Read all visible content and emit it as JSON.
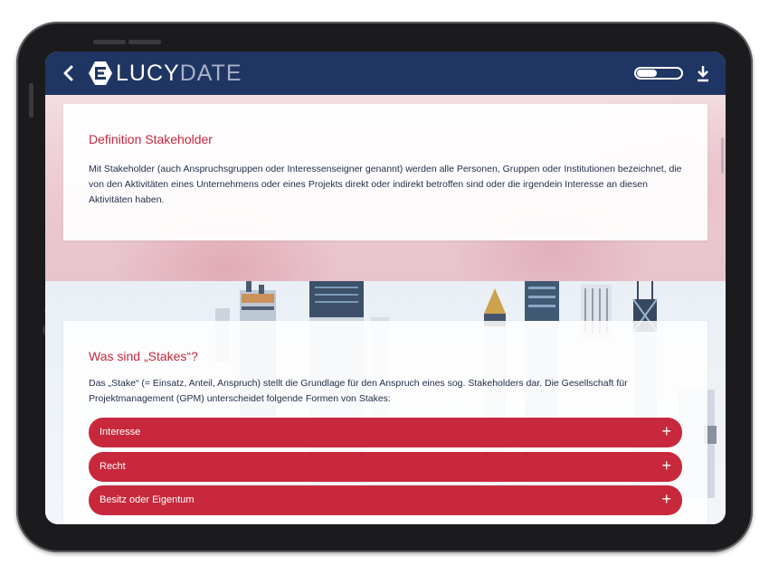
{
  "app": {
    "brand_part1": "LUCY",
    "brand_part2": "DATE"
  },
  "colors": {
    "appbar": "#1f3564",
    "accent": "#c8283c",
    "text": "#1f2c4a"
  },
  "icons": {
    "back": "chevron-left-icon",
    "logo": "lucydate-logo-icon",
    "toggle": "toggle-switch-icon",
    "download": "download-icon",
    "expand": "plus-icon"
  },
  "definition": {
    "title": "Definition Stakeholder",
    "text": "Mit Stakeholder (auch Anspruchsgruppen oder Interessenseigner genannt) werden alle Personen, Gruppen oder Institutionen bezeichnet, die von den Aktivitäten eines Unternehmens oder eines Projekts direkt oder indirekt betroffen sind oder die irgendein Interesse an diesen Aktivitäten haben."
  },
  "stakes": {
    "title": "Was sind „Stakes“?",
    "text": "Das „Stake“ (= Einsatz, Anteil, Anspruch) stellt die Grundlage für den Anspruch eines sog. Stakeholders dar. Die Gesellschaft für Projektmanagement (GPM) unterscheidet folgende Formen von Stakes:",
    "items": [
      {
        "label": "Interesse",
        "icon": "+"
      },
      {
        "label": "Recht",
        "icon": "+"
      },
      {
        "label": "Besitz oder Eigentum",
        "icon": "+"
      }
    ]
  }
}
